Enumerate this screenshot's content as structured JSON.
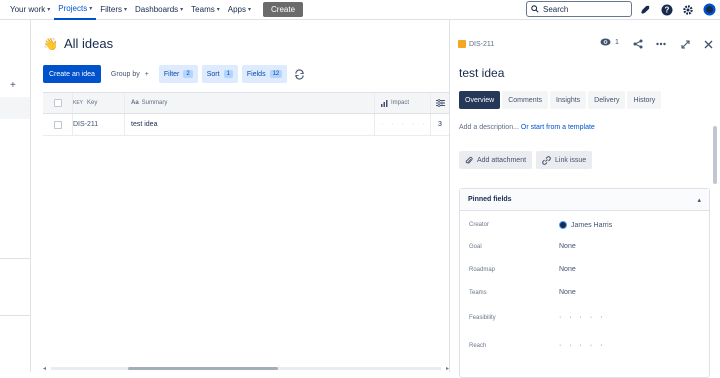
{
  "nav": {
    "items": [
      {
        "label": "Your work",
        "has_menu": true
      },
      {
        "label": "Projects",
        "has_menu": true,
        "active": true
      },
      {
        "label": "Filters",
        "has_menu": true
      },
      {
        "label": "Dashboards",
        "has_menu": true
      },
      {
        "label": "Teams",
        "has_menu": true
      },
      {
        "label": "Apps",
        "has_menu": true
      }
    ],
    "create_label": "Create",
    "search_placeholder": "Search",
    "icons": [
      "notifications-icon",
      "help-icon",
      "settings-icon",
      "profile-avatar"
    ]
  },
  "page": {
    "title": "All ideas",
    "title_icon": "👋"
  },
  "toolbar": {
    "create_idea": "Create an idea",
    "group_by": "Group by",
    "group_by_suffix": "+",
    "filter": "Filter",
    "filter_count": "2",
    "sort": "Sort",
    "sort_count": "1",
    "fields": "Fields",
    "fields_count": "12"
  },
  "table": {
    "headers": {
      "key": "Key",
      "summary": "Summary",
      "impact": "Impact"
    },
    "rows": [
      {
        "key": "DIS-211",
        "summary": "test idea",
        "impact_dots": "· · · · ·",
        "extra": "3"
      }
    ]
  },
  "panel": {
    "key": "DIS-211",
    "watchers": "1",
    "title": "test idea",
    "tabs": [
      "Overview",
      "Comments",
      "Insights",
      "Delivery",
      "History"
    ],
    "active_tab": "Overview",
    "description_placeholder": "Add a description...",
    "template_link": "Or start from a template",
    "add_attachment": "Add attachment",
    "link_issue": "Link issue",
    "pinned_title": "Pinned fields",
    "fields": [
      {
        "label": "Creator",
        "value": "James Harris"
      },
      {
        "label": "Goal",
        "value": "None"
      },
      {
        "label": "Roadmap",
        "value": "None"
      },
      {
        "label": "Teams",
        "value": "None"
      },
      {
        "label": "Feasibility",
        "value": "· · · · ·"
      },
      {
        "label": "Reach",
        "value": "· · · · ·"
      }
    ]
  },
  "colors": {
    "primary": "#0052cc",
    "active_tab": "#253858",
    "light_button": "#deebff",
    "key_icon": "#f5a623"
  }
}
